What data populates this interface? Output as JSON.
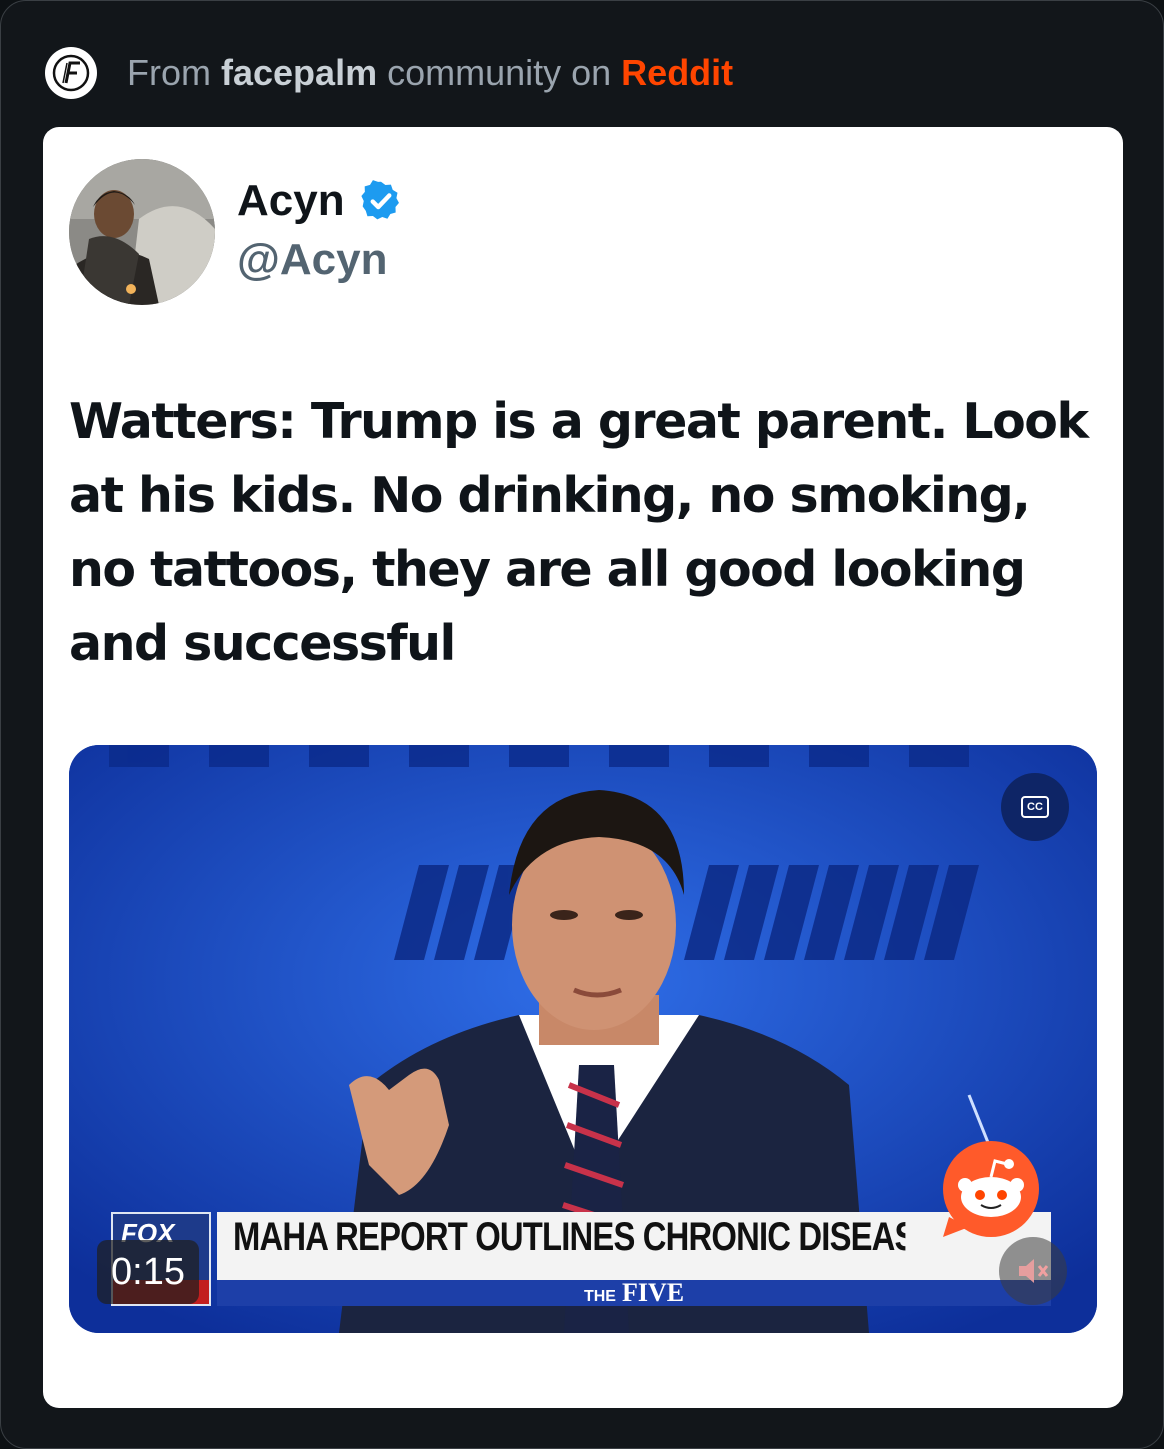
{
  "header": {
    "prefix": "From ",
    "community": "facepalm",
    "middle": " community on ",
    "platform": "Reddit"
  },
  "tweet": {
    "display_name": "Acyn",
    "handle": "@Acyn",
    "verified": true,
    "text": "Watters: Trump is a great parent. Look at his kids. No drinking, no smoking, no tattoos, they are all good looking and successful"
  },
  "video": {
    "timestamp": "0:15",
    "chyron": "MAHA REPORT OUTLINES CHRONIC DISEASE CRISIS",
    "show_prefix": "THE",
    "show_name": "FIVE",
    "network": "FOX",
    "cc_label": "CC",
    "controls": [
      "cc-icon",
      "mute-icon"
    ]
  },
  "colors": {
    "reddit_orange": "#ff4500",
    "verified_blue": "#1d9bf0",
    "background": "#12161a",
    "card": "#ffffff"
  }
}
